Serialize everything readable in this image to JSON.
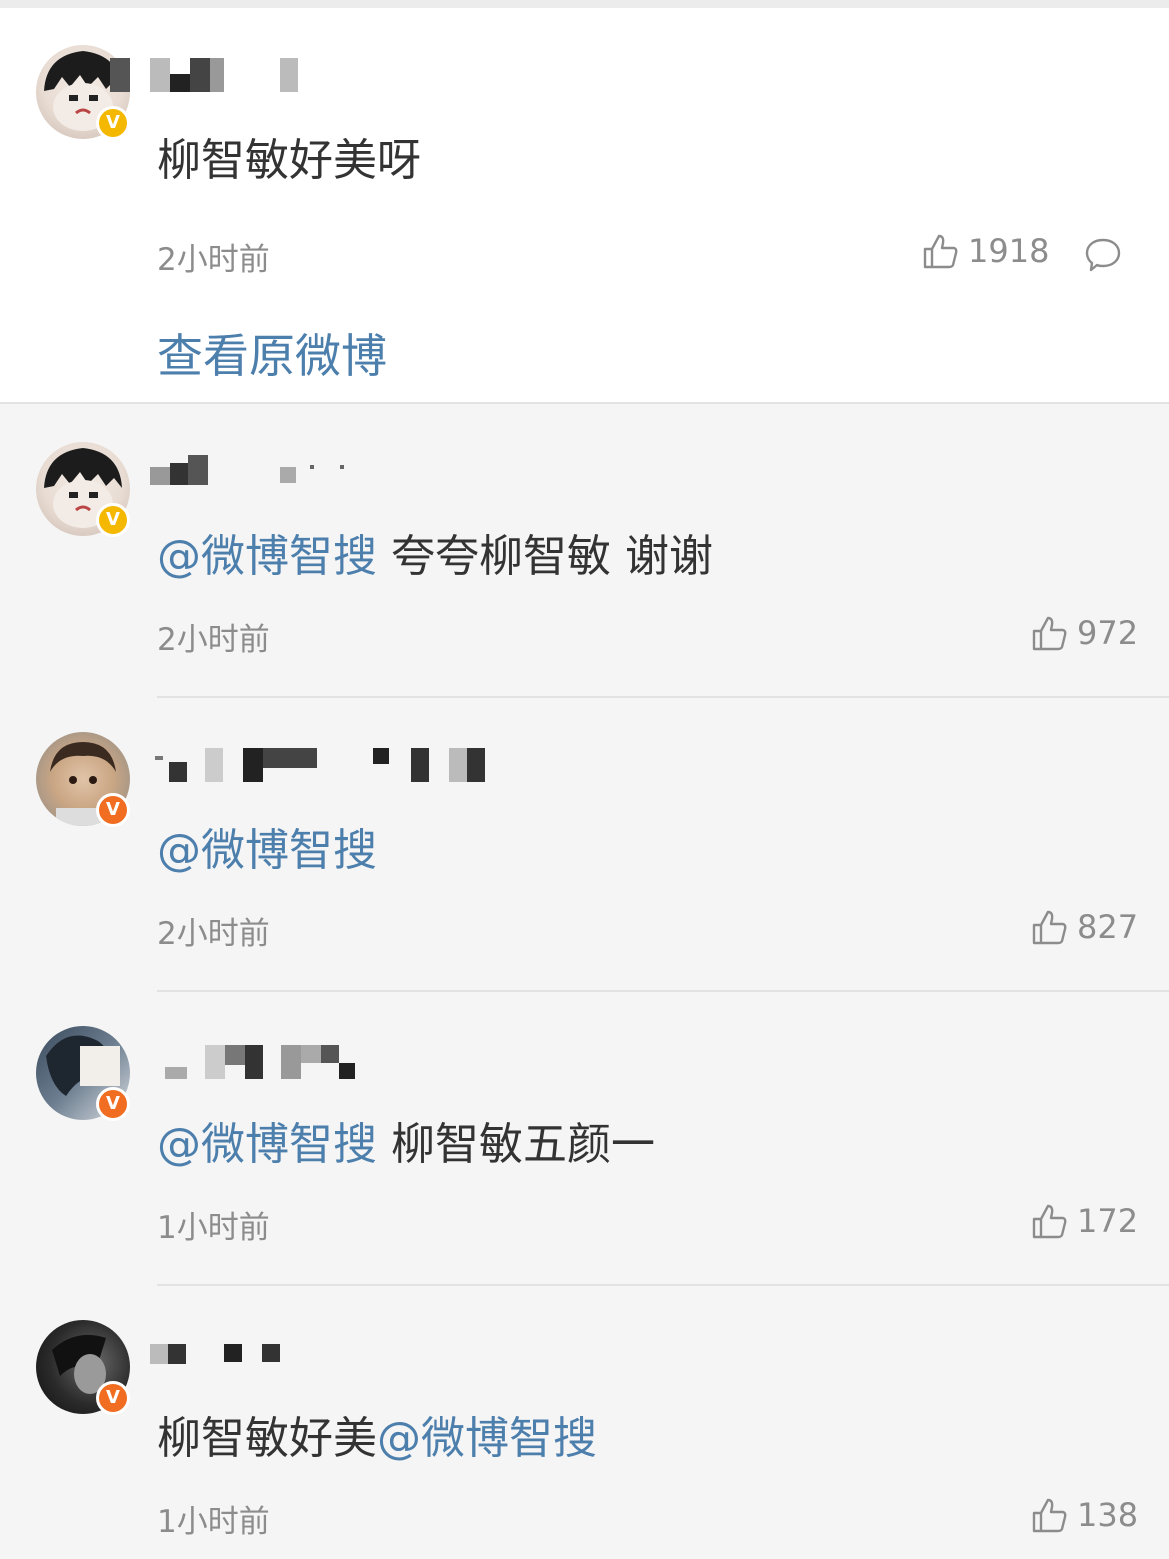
{
  "main_comment": {
    "text": "柳智敏好美呀",
    "time": "2小时前",
    "likes": "1918",
    "badge": "V",
    "view_original": "查看原微博"
  },
  "replies": [
    {
      "mention": "@微博智搜",
      "text": " 夸夸柳智敏 谢谢",
      "time": "2小时前",
      "likes": "972",
      "badge": "V"
    },
    {
      "mention": "@微博智搜",
      "text": "",
      "time": "2小时前",
      "likes": "827",
      "badge": "V"
    },
    {
      "mention": "@微博智搜",
      "text": " 柳智敏五颜一",
      "time": "1小时前",
      "likes": "172",
      "badge": "V"
    },
    {
      "prefix": "柳智敏好美",
      "mention": "@微博智搜",
      "time": "1小时前",
      "likes": "138",
      "badge": "V"
    }
  ],
  "colors": {
    "link": "#4d7fad",
    "badge_yellow": "#f5b800",
    "badge_orange": "#f06d22",
    "muted": "#8c8c8c"
  },
  "icons": [
    "thumbs-up-icon",
    "comment-bubble-icon",
    "verified-badge-icon"
  ]
}
